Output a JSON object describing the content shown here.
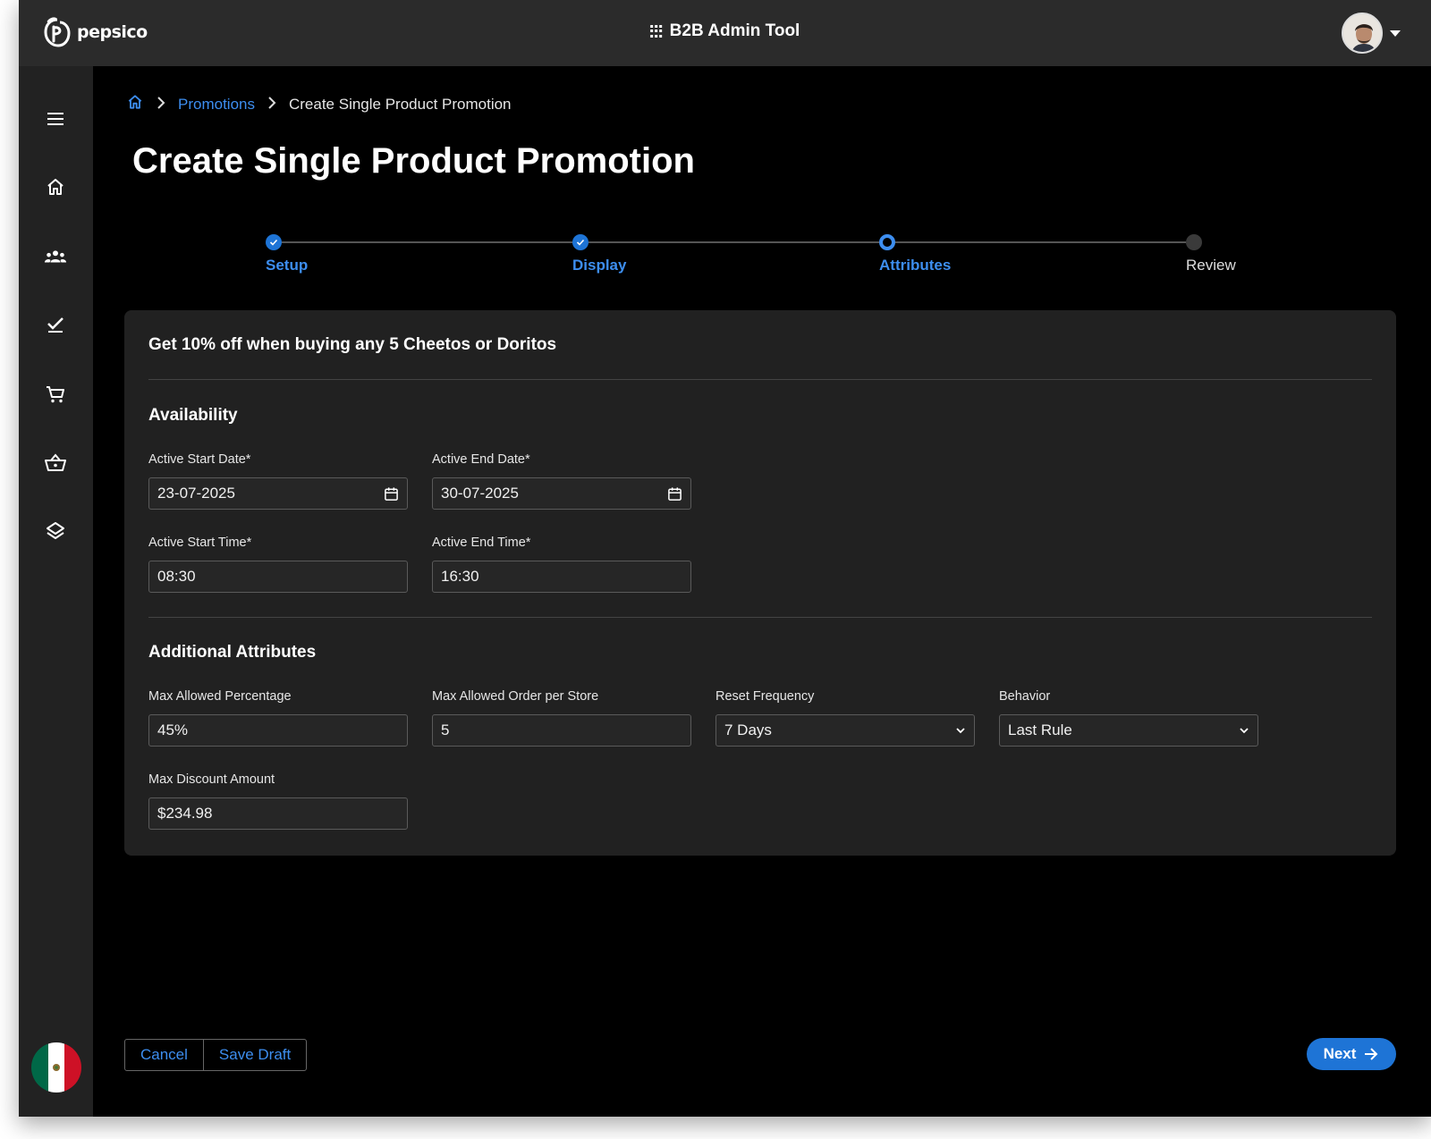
{
  "header": {
    "brand": "pepsico",
    "app_title": "B2B Admin Tool"
  },
  "sidebar": {
    "items": [
      {
        "icon": "menu-icon"
      },
      {
        "icon": "home-icon"
      },
      {
        "icon": "users-icon"
      },
      {
        "icon": "checklist-icon"
      },
      {
        "icon": "cart-icon"
      },
      {
        "icon": "basket-icon"
      },
      {
        "icon": "layers-icon"
      }
    ],
    "flag_colors": [
      "#006847",
      "#ffffff",
      "#ce1126"
    ]
  },
  "breadcrumb": {
    "link": "Promotions",
    "current": "Create Single Product Promotion"
  },
  "page_title": "Create Single Product Promotion",
  "stepper": {
    "steps": [
      {
        "label": "Setup",
        "state": "done"
      },
      {
        "label": "Display",
        "state": "done"
      },
      {
        "label": "Attributes",
        "state": "active"
      },
      {
        "label": "Review",
        "state": "todo"
      }
    ]
  },
  "card": {
    "title": "Get 10% off when buying any 5 Cheetos or Doritos",
    "availability": {
      "title": "Availability",
      "start_date_label": "Active Start Date*",
      "start_date": "23-07-2025",
      "end_date_label": "Active End Date*",
      "end_date": "30-07-2025",
      "start_time_label": "Active Start Time*",
      "start_time": "08:30",
      "end_time_label": "Active End Time*",
      "end_time": "16:30"
    },
    "additional": {
      "title": "Additional Attributes",
      "max_pct_label": "Max Allowed Percentage",
      "max_pct": "45%",
      "max_order_label": "Max Allowed Order per Store",
      "max_order": "5",
      "reset_label": "Reset Frequency",
      "reset": "7 Days",
      "behavior_label": "Behavior",
      "behavior": "Last Rule",
      "max_discount_label": "Max Discount Amount",
      "max_discount": "$234.98"
    }
  },
  "footer": {
    "cancel": "Cancel",
    "save_draft": "Save Draft",
    "next": "Next"
  },
  "colors": {
    "accent": "#1e74d6",
    "link": "#3d8ef0",
    "card_bg": "#212121",
    "topbar_bg": "#2b2b2b"
  }
}
